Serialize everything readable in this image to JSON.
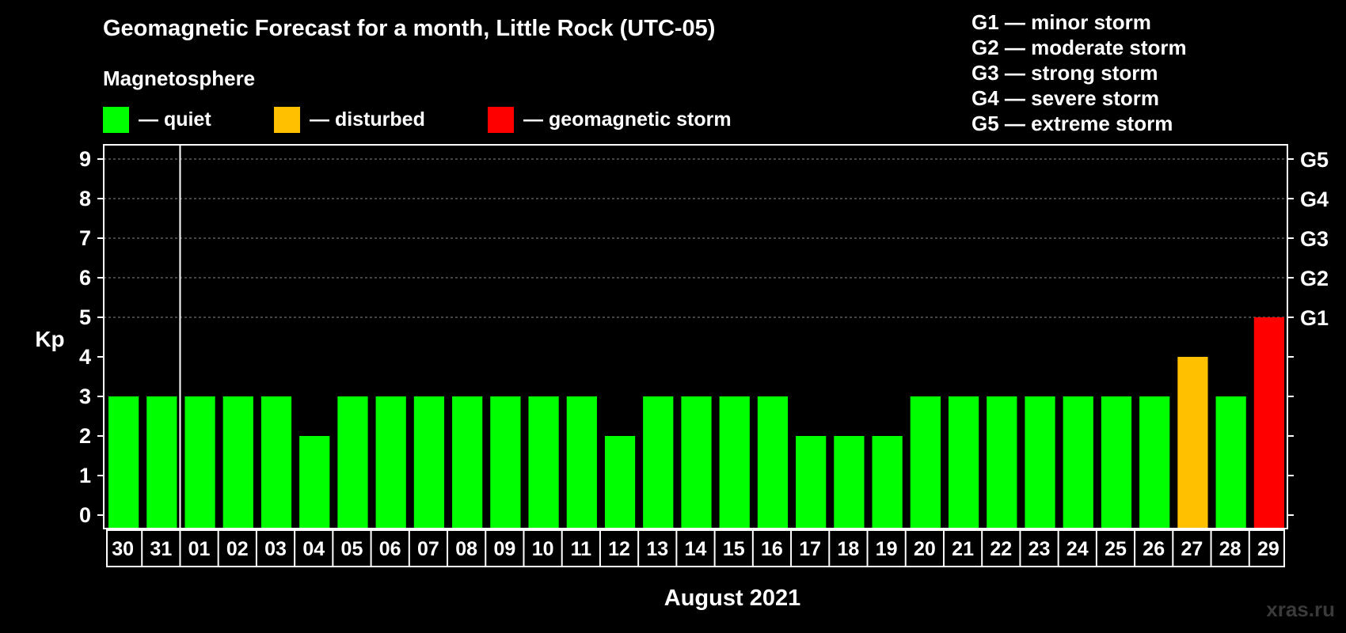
{
  "title": "Geomagnetic Forecast for a month, Little Rock (UTC-05)",
  "legend": {
    "heading": "Magnetosphere",
    "items": [
      {
        "label": "— quiet",
        "color": "#00ff00"
      },
      {
        "label": "— disturbed",
        "color": "#ffc000"
      },
      {
        "label": "— geomagnetic storm",
        "color": "#ff0000"
      }
    ]
  },
  "storm_scale": [
    "G1 — minor storm",
    "G2 — moderate storm",
    "G3 — strong storm",
    "G4 — severe storm",
    "G5 — extreme storm"
  ],
  "watermark": "xras.ru",
  "chart_data": {
    "type": "bar",
    "ylabel": "Kp",
    "xlabel": "August 2021",
    "ylim": [
      0,
      9
    ],
    "yticks": [
      0,
      1,
      2,
      3,
      4,
      5,
      6,
      7,
      8,
      9
    ],
    "right_axis_labels": [
      {
        "kp": 5,
        "label": "G1"
      },
      {
        "kp": 6,
        "label": "G2"
      },
      {
        "kp": 7,
        "label": "G3"
      },
      {
        "kp": 8,
        "label": "G4"
      },
      {
        "kp": 9,
        "label": "G5"
      }
    ],
    "grid": "dashed horizontal at Kp 5-9",
    "categories": [
      "30",
      "31",
      "01",
      "02",
      "03",
      "04",
      "05",
      "06",
      "07",
      "08",
      "09",
      "10",
      "11",
      "12",
      "13",
      "14",
      "15",
      "16",
      "17",
      "18",
      "19",
      "20",
      "21",
      "22",
      "23",
      "24",
      "25",
      "26",
      "27",
      "28",
      "29"
    ],
    "values": [
      3,
      3,
      3,
      3,
      3,
      2,
      3,
      3,
      3,
      3,
      3,
      3,
      3,
      2,
      3,
      3,
      3,
      3,
      2,
      2,
      2,
      3,
      3,
      3,
      3,
      3,
      3,
      3,
      4,
      3,
      5
    ],
    "colors": {
      "quiet": "#00ff00",
      "disturbed": "#ffc000",
      "storm": "#ff0000"
    },
    "month_separator_after": "31"
  }
}
